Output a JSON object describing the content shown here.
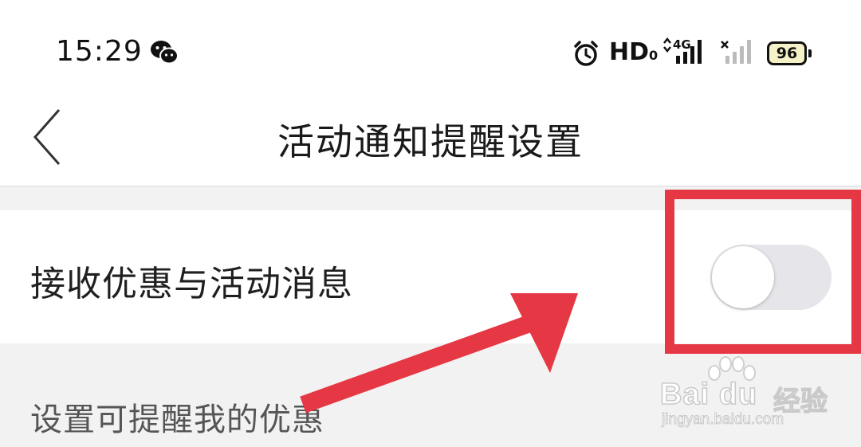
{
  "status_bar": {
    "time": "15:29",
    "hd": "HD",
    "hd_sub": "0",
    "network": "4G",
    "battery": "96",
    "icons": [
      "wechat-icon",
      "alarm-icon",
      "signal-4g-icon",
      "no-sim-icon",
      "battery-icon"
    ]
  },
  "nav": {
    "title": "活动通知提醒设置",
    "back_icon": "chevron-left-icon"
  },
  "setting": {
    "label": "接收优惠与活动消息",
    "toggle_on": false
  },
  "section_hint": "设置可提醒我的优惠",
  "annotation": {
    "box_color": "#e63744",
    "arrow_color": "#e63744"
  },
  "watermark": {
    "logo": "Bai du",
    "cn": "经验",
    "url": "jingyan.baidu.com"
  }
}
